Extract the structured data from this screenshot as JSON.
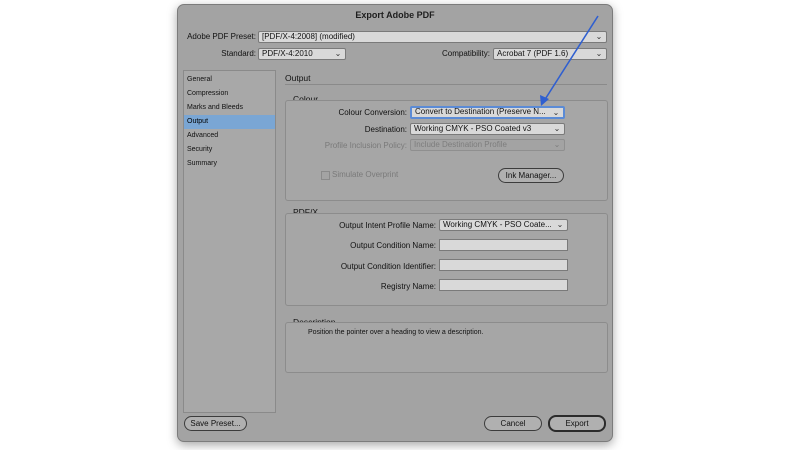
{
  "dialog": {
    "title": "Export Adobe PDF"
  },
  "header": {
    "preset_label": "Adobe PDF Preset:",
    "preset_value": "[PDF/X-4:2008] (modified)",
    "standard_label": "Standard:",
    "standard_value": "PDF/X-4:2010",
    "compatibility_label": "Compatibility:",
    "compatibility_value": "Acrobat 7 (PDF 1.6)"
  },
  "sidebar": {
    "items": [
      {
        "label": "General"
      },
      {
        "label": "Compression"
      },
      {
        "label": "Marks and Bleeds"
      },
      {
        "label": "Output"
      },
      {
        "label": "Advanced"
      },
      {
        "label": "Security"
      },
      {
        "label": "Summary"
      }
    ],
    "selected": "Output"
  },
  "panel": {
    "title": "Output",
    "colour": {
      "title": "Colour",
      "conversion_label": "Colour Conversion:",
      "conversion_value": "Convert to Destination (Preserve N...",
      "destination_label": "Destination:",
      "destination_value": "Working CMYK - PSO Coated v3",
      "profile_label": "Profile Inclusion Policy:",
      "profile_value": "Include Destination Profile",
      "simulate_label": "Simulate Overprint",
      "ink_manager_label": "Ink Manager..."
    },
    "pdfx": {
      "title": "PDF/X",
      "intent_label": "Output Intent Profile Name:",
      "intent_value": "Working CMYK - PSO Coate...",
      "condition_name_label": "Output Condition Name:",
      "condition_name_value": "",
      "condition_id_label": "Output Condition Identifier:",
      "condition_id_value": "",
      "registry_label": "Registry Name:",
      "registry_value": ""
    },
    "description": {
      "title": "Description",
      "text": "Position the pointer over a heading to view a description."
    }
  },
  "footer": {
    "save_preset_label": "Save Preset...",
    "cancel_label": "Cancel",
    "export_label": "Export"
  },
  "colors": {
    "accent": "#7aa6d4",
    "focus_ring": "#5b8bd6",
    "annotation_arrow": "#2f5fd0",
    "dialog_bg": "#a3a3a3"
  }
}
